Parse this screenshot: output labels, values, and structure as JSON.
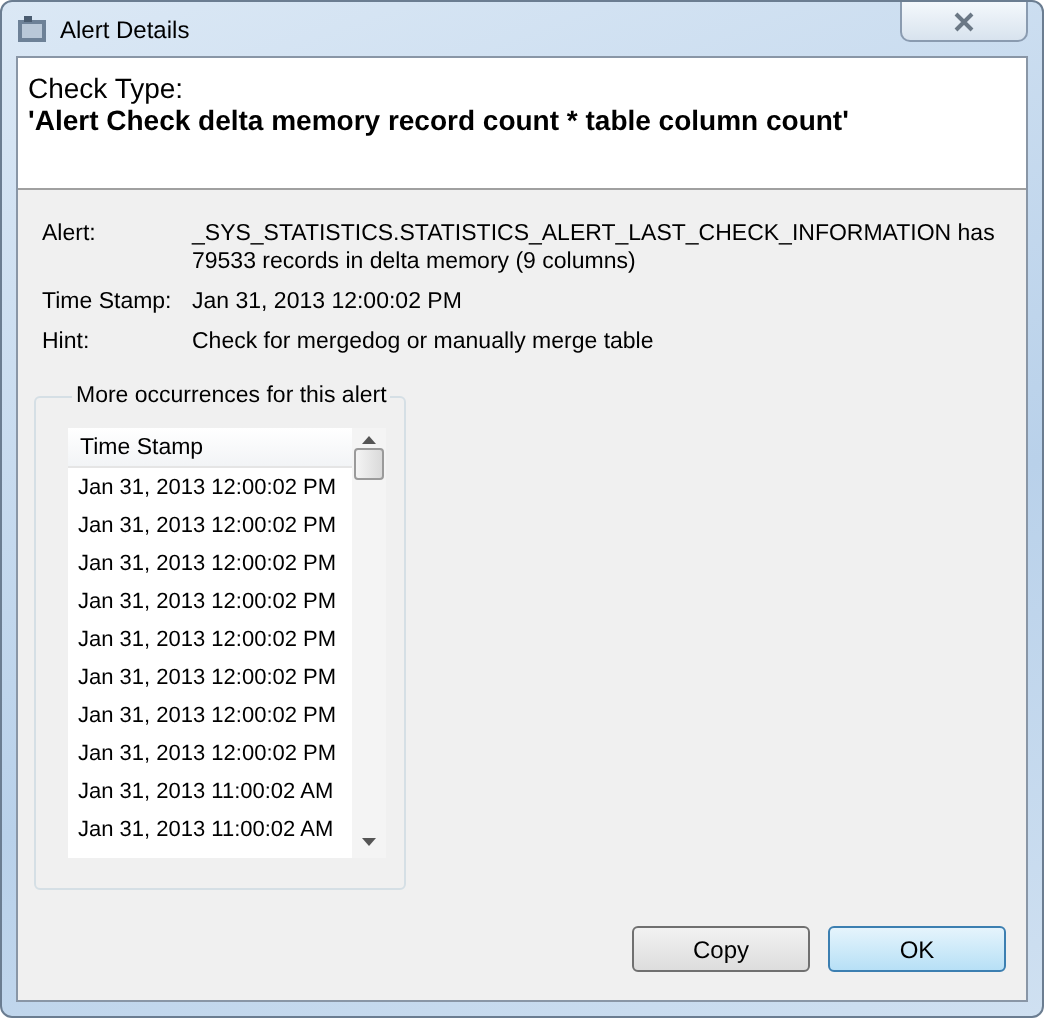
{
  "window": {
    "title": "Alert Details"
  },
  "header": {
    "label": "Check Type:",
    "value": "'Alert Check delta memory record count * table column count'"
  },
  "details": [
    {
      "label": "Alert:",
      "value": "_SYS_STATISTICS.STATISTICS_ALERT_LAST_CHECK_INFORMATION has 79533 records in delta memory (9 columns)"
    },
    {
      "label": "Time Stamp:",
      "value": "Jan 31, 2013 12:00:02 PM"
    },
    {
      "label": "Hint:",
      "value": "Check for mergedog or manually merge table"
    }
  ],
  "occurrences": {
    "title": "More occurrences for this alert",
    "columns": [
      "Time Stamp"
    ],
    "rows": [
      "Jan 31, 2013 12:00:02 PM",
      "Jan 31, 2013 12:00:02 PM",
      "Jan 31, 2013 12:00:02 PM",
      "Jan 31, 2013 12:00:02 PM",
      "Jan 31, 2013 12:00:02 PM",
      "Jan 31, 2013 12:00:02 PM",
      "Jan 31, 2013 12:00:02 PM",
      "Jan 31, 2013 12:00:02 PM",
      "Jan 31, 2013 11:00:02 AM",
      "Jan 31, 2013 11:00:02 AM"
    ]
  },
  "buttons": [
    {
      "label": "Copy",
      "default": false
    },
    {
      "label": "OK",
      "default": true
    }
  ]
}
